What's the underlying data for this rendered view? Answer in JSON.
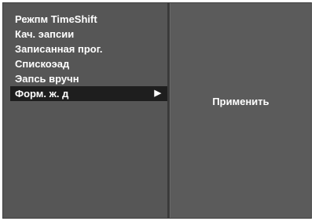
{
  "menu": {
    "items": [
      {
        "label": "Режпм TimeShift"
      },
      {
        "label": "Кач. эапсии"
      },
      {
        "label": "Записанная прог."
      },
      {
        "label": "Спискоэад"
      },
      {
        "label": "Эапсь вручн"
      },
      {
        "label": "Форм. ж. д",
        "selected": true,
        "arrow": "▶"
      }
    ]
  },
  "submenu": {
    "apply_label": "Применить"
  },
  "colors": {
    "panel_bg": "#565656",
    "selected_bg": "#1e1e1e",
    "text": "#ffffff"
  }
}
